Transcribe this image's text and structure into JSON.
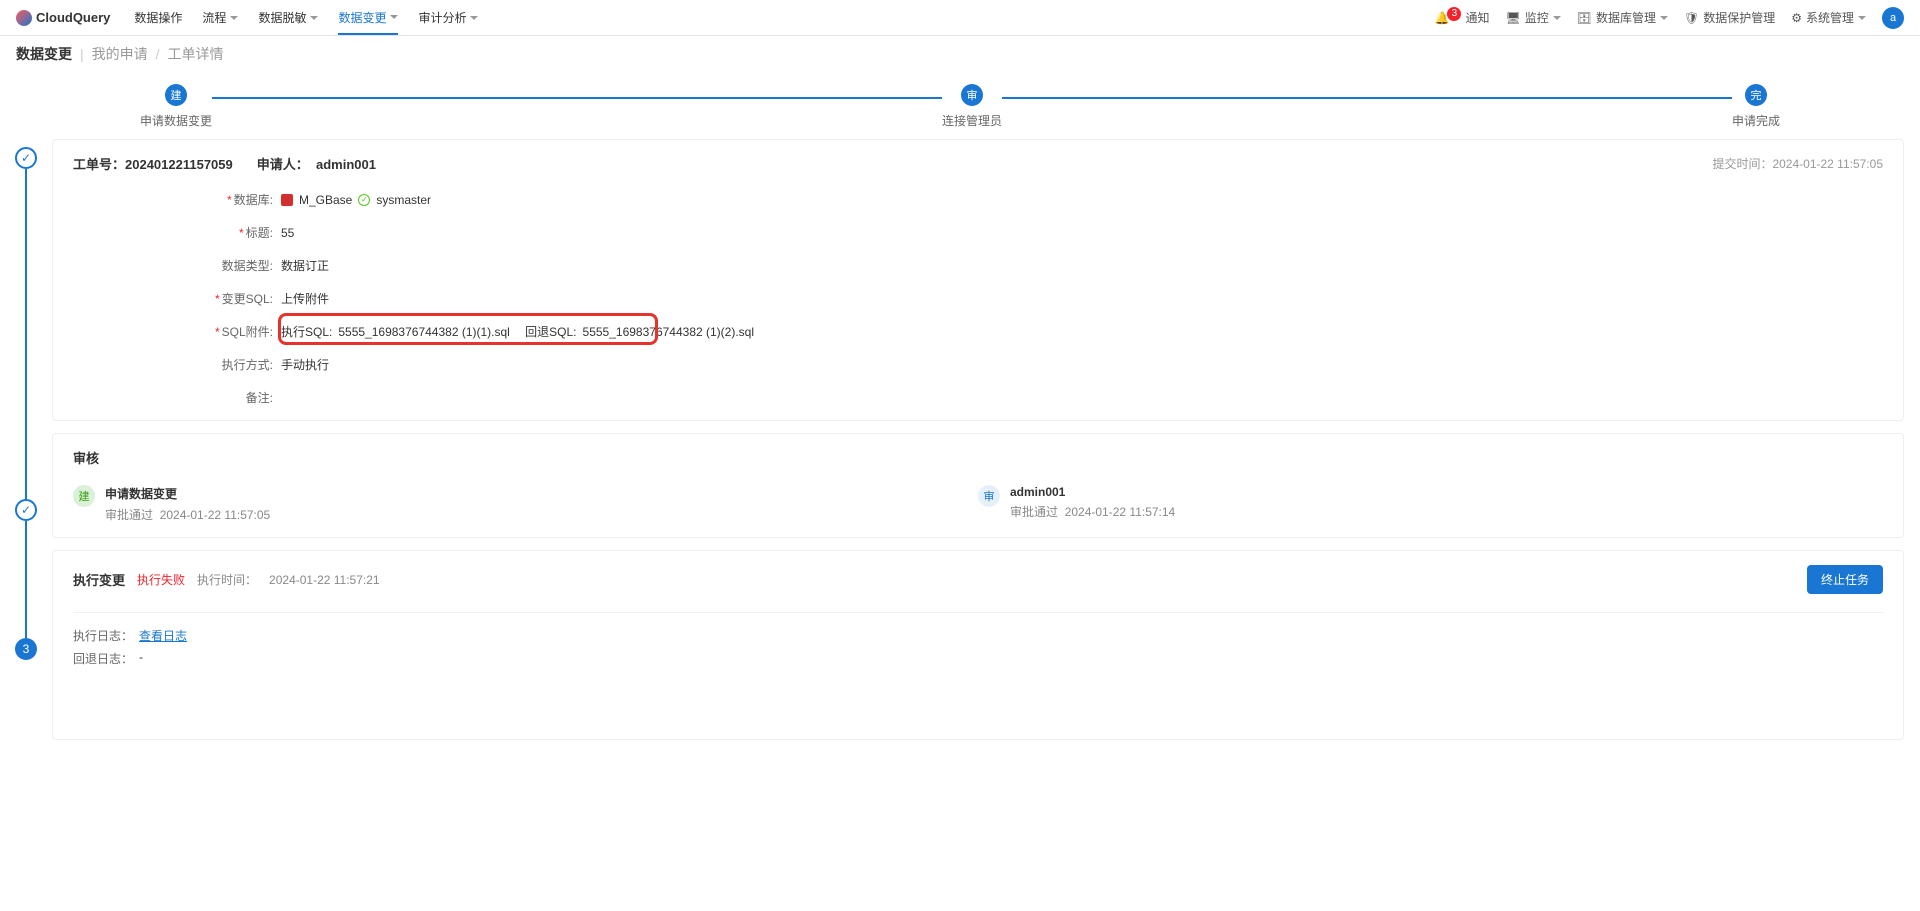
{
  "brand": "CloudQuery",
  "nav": {
    "items": [
      {
        "label": "数据操作",
        "dropdown": false
      },
      {
        "label": "流程",
        "dropdown": true
      },
      {
        "label": "数据脱敏",
        "dropdown": true
      },
      {
        "label": "数据变更",
        "dropdown": true,
        "active": true
      },
      {
        "label": "审计分析",
        "dropdown": true
      }
    ]
  },
  "topright": {
    "notice": {
      "label": "通知",
      "badge": "3"
    },
    "monitor": {
      "label": "监控"
    },
    "dbmgmt": {
      "label": "数据库管理"
    },
    "dataprotect": {
      "label": "数据保护管理"
    },
    "sysmgmt": {
      "label": "系统管理"
    },
    "avatar": "a"
  },
  "breadcrumb": {
    "title": "数据变更",
    "my_apply": "我的申请",
    "detail": "工单详情"
  },
  "steps": [
    {
      "icon": "建",
      "label": "申请数据变更"
    },
    {
      "icon": "审",
      "label": "连接管理员"
    },
    {
      "icon": "完",
      "label": "申请完成"
    }
  ],
  "order": {
    "order_no_label": "工单号：",
    "order_no": "202401221157059",
    "applicant_label": "申请人：",
    "applicant": "admin001",
    "submit_time_label": "提交时间：",
    "submit_time": "2024-01-22 11:57:05",
    "fields": {
      "db_label": "数据库:",
      "db_conn": "M_GBase",
      "db_name": "sysmaster",
      "title_label": "标题:",
      "title_value": "55",
      "type_label": "数据类型:",
      "type_value": "数据订正",
      "changesql_label": "变更SQL:",
      "changesql_value": "上传附件",
      "sqlattach_label": "SQL附件:",
      "exec_sql_label": "执行SQL:",
      "exec_sql_file": "5555_1698376744382 (1)(1).sql",
      "rollback_sql_label": "回退SQL:",
      "rollback_sql_file": "5555_1698376744382 (1)(2).sql",
      "exec_mode_label": "执行方式:",
      "exec_mode_value": "手动执行",
      "remark_label": "备注:",
      "remark_value": ""
    }
  },
  "audit": {
    "title": "审核",
    "col1": {
      "badge": "建",
      "name": "申请数据变更",
      "status": "审批通过",
      "time": "2024-01-22 11:57:05"
    },
    "col2": {
      "badge": "审",
      "name": "admin001",
      "status": "审批通过",
      "time": "2024-01-22 11:57:14"
    }
  },
  "exec": {
    "title": "执行变更",
    "status": "执行失败",
    "time_label": "执行时间：",
    "time": "2024-01-22 11:57:21",
    "stop_btn": "终止任务",
    "exec_log_label": "执行日志：",
    "exec_log_link": "查看日志",
    "rollback_log_label": "回退日志：",
    "rollback_log_value": "-"
  },
  "timeline_step3": "3"
}
